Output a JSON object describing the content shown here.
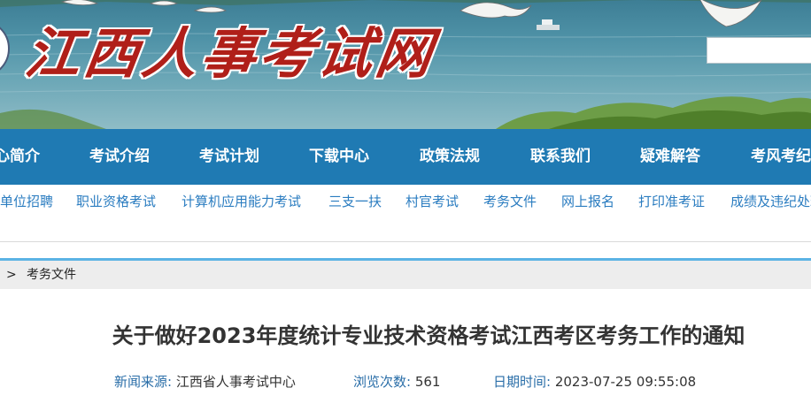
{
  "header": {
    "site_title": "江西人事考试网",
    "search_value": ""
  },
  "main_nav": {
    "items": [
      {
        "label": "心简介"
      },
      {
        "label": "考试介绍"
      },
      {
        "label": "考试计划"
      },
      {
        "label": "下载中心"
      },
      {
        "label": "政策法规"
      },
      {
        "label": "联系我们"
      },
      {
        "label": "疑难解答"
      },
      {
        "label": "考风考纪"
      }
    ]
  },
  "sub_nav": {
    "items": [
      {
        "label": "单位招聘"
      },
      {
        "label": "职业资格考试"
      },
      {
        "label": "计算机应用能力考试"
      },
      {
        "label": "三支一扶"
      },
      {
        "label": "村官考试"
      },
      {
        "label": "考务文件"
      },
      {
        "label": "网上报名"
      },
      {
        "label": "打印准考证"
      },
      {
        "label": "成绩及违纪处理"
      }
    ]
  },
  "breadcrumb": {
    "separator": ">",
    "current": "考务文件"
  },
  "article": {
    "title": "关于做好2023年度统计专业技术资格考试江西考区考务工作的通知",
    "source_label": "新闻来源:",
    "source_value": "江西省人事考试中心",
    "views_label": "浏览次数:",
    "views_value": "561",
    "date_label": "日期时间:",
    "date_value": "2023-07-25 09:55:08"
  },
  "colors": {
    "nav_background": "#1f7ab3",
    "sub_nav_text": "#2a7cc0",
    "title_red": "#b01f19",
    "breadcrumb_accent": "#5bb3e4"
  }
}
